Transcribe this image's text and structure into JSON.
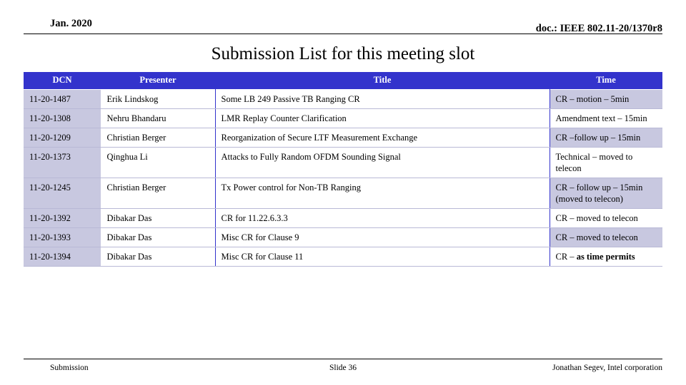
{
  "header": {
    "left": "Jan. 2020",
    "right": "doc.: IEEE 802.11-20/1370r8"
  },
  "title": "Submission List for this meeting slot",
  "table": {
    "columns": [
      "DCN",
      "Presenter",
      "Title",
      "Time"
    ],
    "rows": [
      {
        "dcn": "11-20-1487",
        "presenter": "Erik Lindskog",
        "title": "Some LB 249 Passive TB Ranging CR",
        "time": "CR – motion – 5min",
        "time_bold": ""
      },
      {
        "dcn": "11-20-1308",
        "presenter": "Nehru Bhandaru",
        "title": "LMR Replay Counter Clarification",
        "time": "Amendment text – 15min",
        "time_bold": ""
      },
      {
        "dcn": "11-20-1209",
        "presenter": "Christian Berger",
        "title": "Reorganization of Secure LTF Measurement Exchange",
        "time": "CR –follow up – 15min",
        "time_bold": ""
      },
      {
        "dcn": "11-20-1373",
        "presenter": "Qinghua Li",
        "title": "Attacks to Fully Random OFDM Sounding Signal",
        "time": "Technical – moved to telecon",
        "time_bold": ""
      },
      {
        "dcn": "11-20-1245",
        "presenter": "Christian Berger",
        "title": "Tx Power control for Non-TB Ranging",
        "time": "CR – follow up – 15min (moved to telecon)",
        "time_bold": ""
      },
      {
        "dcn": "11-20-1392",
        "presenter": "Dibakar Das",
        "title": "CR for 11.22.6.3.3",
        "time": "CR – moved to telecon",
        "time_bold": ""
      },
      {
        "dcn": "11-20-1393",
        "presenter": "Dibakar Das",
        "title": "Misc CR for Clause 9",
        "time": "CR – moved to telecon",
        "time_bold": ""
      },
      {
        "dcn": "11-20-1394",
        "presenter": "Dibakar Das",
        "title": "Misc CR for Clause 11",
        "time": "CR – ",
        "time_bold": "as time permits"
      }
    ]
  },
  "footer": {
    "left": "Submission",
    "center": "Slide 36",
    "right": "Jonathan Segev, Intel corporation"
  },
  "colors": {
    "header_fill": "#3333CC",
    "accent_cell": "#C8C8E0"
  }
}
